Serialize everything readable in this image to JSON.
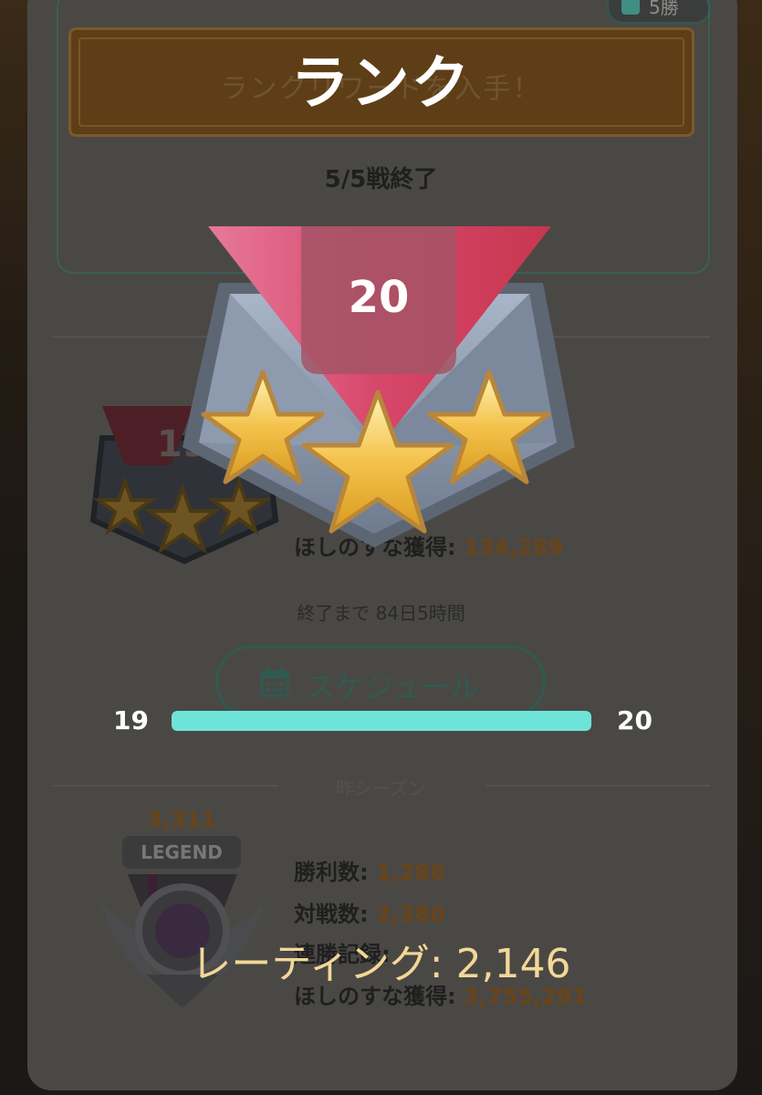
{
  "overlay": {
    "title": "ランク",
    "new_rank": "20",
    "progress": {
      "from": "19",
      "to": "20",
      "fill_percent": 100
    },
    "rating_label": "レーティング: 2,146"
  },
  "background": {
    "top_badge": "5勝",
    "reward_banner": "ランクリワードを入手！",
    "battles_done": "5/5戦終了",
    "current_rank": {
      "badge_number": "19",
      "stardust_label": "ほしのすな獲得:",
      "stardust_value": "134,289"
    },
    "time_left": "終了まで 84日5時間",
    "schedule_button": "スケジュール",
    "last_season": {
      "heading": "昨シーズン",
      "rating": "3,311",
      "tier": "LEGEND",
      "wins_label": "勝利数:",
      "wins_value": "1,286",
      "battles_label": "対戦数:",
      "battles_value": "2,380",
      "streak_label": "連勝記録:",
      "stardust_label": "ほしのすな獲得:",
      "stardust_value": "3,755,291"
    }
  },
  "colors": {
    "progress_fill": "#6ee4d9",
    "banner_pink": "#d6476a",
    "star_gold": "#f4c24a",
    "rating_text": "#f3d798"
  }
}
